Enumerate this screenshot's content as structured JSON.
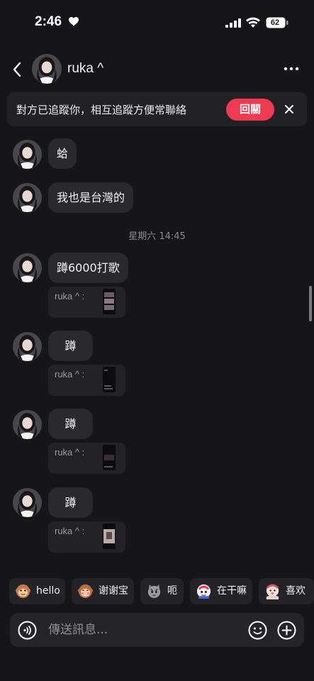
{
  "status_bar": {
    "time": "2:46",
    "battery": "62"
  },
  "header": {
    "contact_name": "ruka ^"
  },
  "follow_banner": {
    "text": "對方已追蹤你，相互追蹤方便常聯絡",
    "button_label": "回關"
  },
  "messages": [
    {
      "text": "蛤"
    },
    {
      "text": "我也是台灣的"
    },
    {
      "text": "蹲6000打歌"
    },
    {
      "text": "蹲"
    },
    {
      "text": "蹲"
    },
    {
      "text": "蹲"
    }
  ],
  "timestamp": "星期六 14:45",
  "reply_cards": [
    {
      "label": "ruka ^ :"
    },
    {
      "label": "ruka ^ :"
    },
    {
      "label": "ruka ^ :"
    },
    {
      "label": "ruka ^ :"
    }
  ],
  "quick_replies": [
    {
      "label": "hello",
      "icon": "monkey-sticker-icon"
    },
    {
      "label": "谢谢宝",
      "icon": "monkey-blush-sticker-icon"
    },
    {
      "label": "呃",
      "icon": "cat-sticker-icon"
    },
    {
      "label": "在干嘛",
      "icon": "red-character-sticker-icon"
    },
    {
      "label": "喜欢",
      "icon": "hug-sticker-icon"
    }
  ],
  "composer": {
    "placeholder": "傳送訊息..."
  },
  "colors": {
    "background": "#161619",
    "accent": "#ef3a52",
    "bubble": "#2a2a2e"
  }
}
